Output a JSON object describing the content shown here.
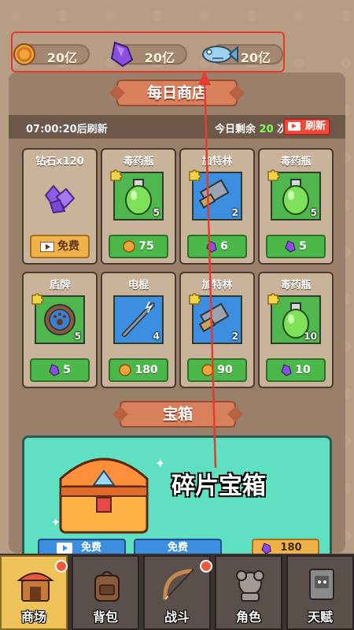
{
  "currency": {
    "coins": "20亿",
    "gems": "20亿",
    "fish": "20亿"
  },
  "shop": {
    "banner": "每日商店",
    "timer": "07:00:20后刷新",
    "remaining_prefix": "今日剩余",
    "remaining_count": "20",
    "remaining_suffix": "次",
    "refresh_label": "刷新",
    "items": [
      {
        "title": "钻石x120",
        "count": "",
        "price": "免费",
        "price_type": "free"
      },
      {
        "title": "毒药瓶",
        "count": "5",
        "price": "75",
        "price_type": "coin"
      },
      {
        "title": "加特林",
        "count": "2",
        "price": "6",
        "price_type": "gem"
      },
      {
        "title": "毒药瓶",
        "count": "5",
        "price": "5",
        "price_type": "gem"
      },
      {
        "title": "盾牌",
        "count": "5",
        "price": "5",
        "price_type": "gem"
      },
      {
        "title": "电棍",
        "count": "4",
        "price": "180",
        "price_type": "coin"
      },
      {
        "title": "加特林",
        "count": "2",
        "price": "90",
        "price_type": "coin"
      },
      {
        "title": "毒药瓶",
        "count": "10",
        "price": "10",
        "price_type": "gem"
      }
    ]
  },
  "chest": {
    "banner": "宝箱",
    "label": "碎片宝箱",
    "btn1": "免费",
    "btn2": "免费",
    "btn3": "180"
  },
  "nav": {
    "tabs": [
      "商场",
      "背包",
      "战斗",
      "角色",
      "天赋"
    ]
  },
  "colors": {
    "highlight": "#e53b2f",
    "accent_green": "#4db84a",
    "accent_red": "#f04a3a"
  }
}
